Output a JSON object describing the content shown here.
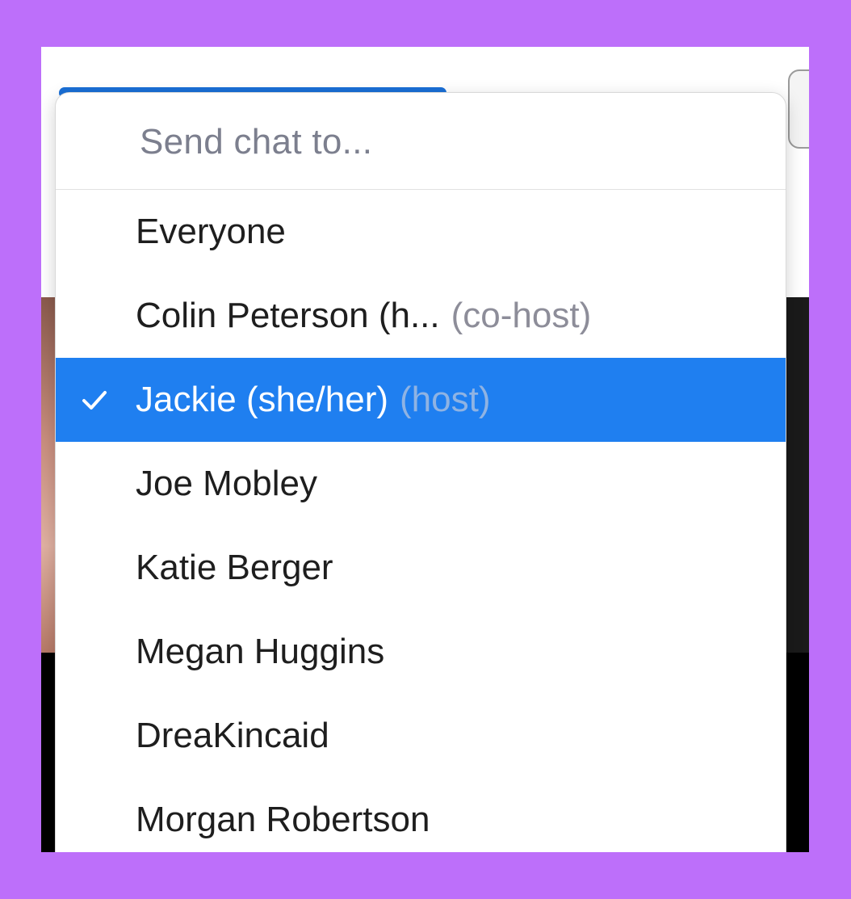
{
  "menu": {
    "header": "Send chat to...",
    "items": [
      {
        "name": "Everyone",
        "role": "",
        "selected": false
      },
      {
        "name": "Colin Peterson (h...",
        "role": "(co-host)",
        "selected": false
      },
      {
        "name": "Jackie (she/her)",
        "role": "(host)",
        "selected": true
      },
      {
        "name": "Joe Mobley",
        "role": "",
        "selected": false
      },
      {
        "name": "Katie Berger",
        "role": "",
        "selected": false
      },
      {
        "name": "Megan Huggins",
        "role": "",
        "selected": false
      },
      {
        "name": "DreaKincaid",
        "role": "",
        "selected": false
      },
      {
        "name": "Morgan Robertson",
        "role": "",
        "selected": false
      }
    ],
    "check_icon": "checkmark-icon"
  },
  "colors": {
    "frame": "#bd6ffa",
    "selected_bg": "#1f7ff0",
    "header_text": "#7c7f8e",
    "role_text": "#8d8d99"
  }
}
